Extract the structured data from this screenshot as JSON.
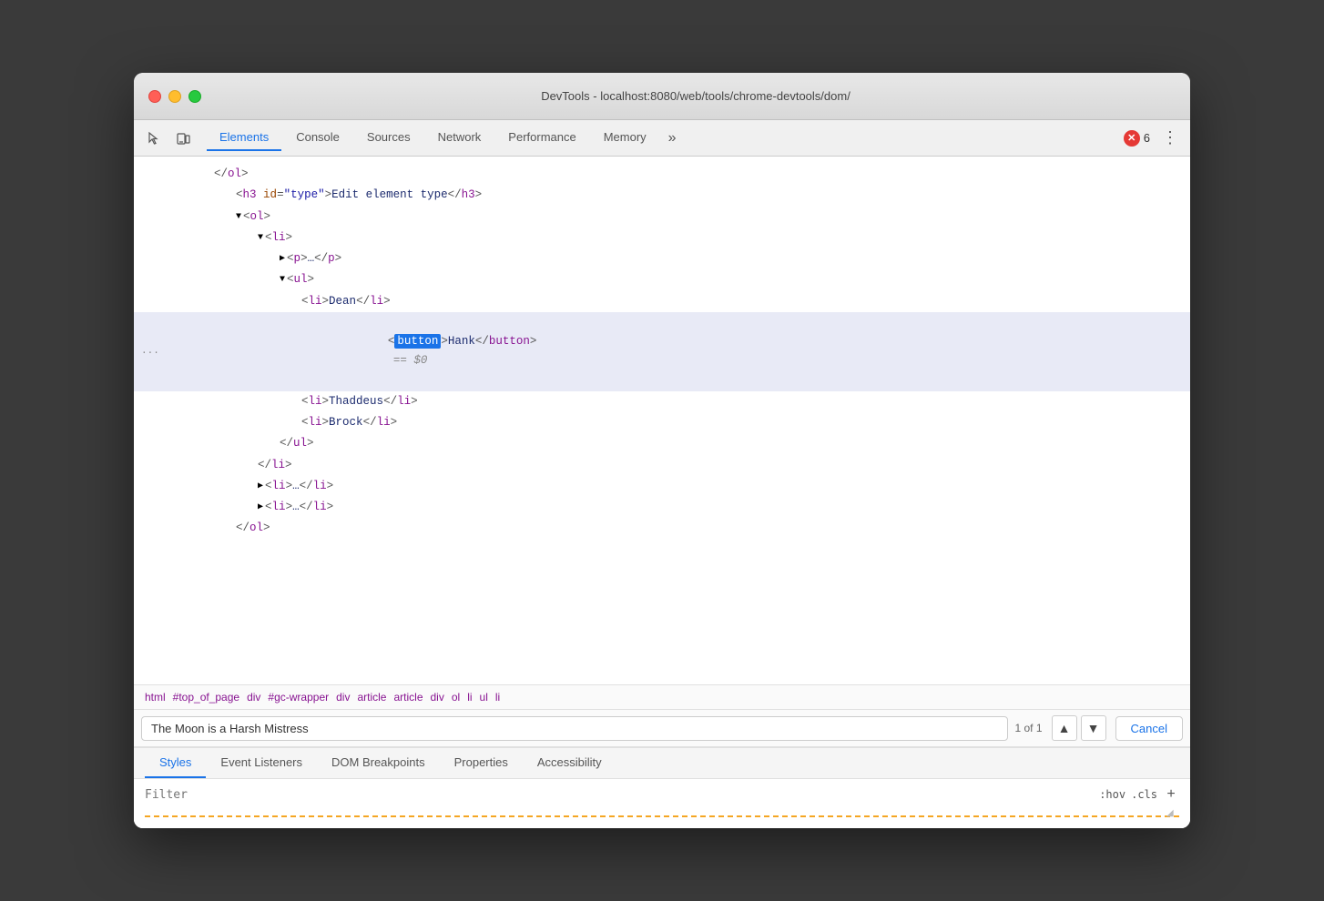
{
  "window": {
    "title": "DevTools - localhost:8080/web/tools/chrome-devtools/dom/"
  },
  "tabs": [
    {
      "label": "Elements",
      "active": true
    },
    {
      "label": "Console",
      "active": false
    },
    {
      "label": "Sources",
      "active": false
    },
    {
      "label": "Network",
      "active": false
    },
    {
      "label": "Performance",
      "active": false
    },
    {
      "label": "Memory",
      "active": false
    }
  ],
  "error_count": "6",
  "dom_lines": [
    {
      "indent": 3,
      "content": "</ol>",
      "type": "tag_close"
    },
    {
      "indent": 4,
      "content": "<h3 id=\"type\">Edit element type</h3>",
      "type": "tag_inline"
    },
    {
      "indent": 4,
      "content": "▼<ol>",
      "type": "tag_open",
      "triangle": "down"
    },
    {
      "indent": 5,
      "content": "▼<li>",
      "type": "tag_open",
      "triangle": "down"
    },
    {
      "indent": 6,
      "content": "▶<p>…</p>",
      "type": "tag_collapsed",
      "triangle": "right"
    },
    {
      "indent": 6,
      "content": "▼<ul>",
      "type": "tag_open",
      "triangle": "down"
    },
    {
      "indent": 7,
      "content": "<li>Dean</li>",
      "type": "tag_inline"
    },
    {
      "indent": 7,
      "content": "<button>Hank</button> == $0",
      "type": "tag_selected",
      "highlighted": true
    },
    {
      "indent": 7,
      "content": "<li>Thaddeus</li>",
      "type": "tag_inline"
    },
    {
      "indent": 7,
      "content": "<li>Brock</li>",
      "type": "tag_inline"
    },
    {
      "indent": 6,
      "content": "</ul>",
      "type": "tag_close"
    },
    {
      "indent": 5,
      "content": "</li>",
      "type": "tag_close"
    },
    {
      "indent": 5,
      "content": "▶<li>…</li>",
      "type": "tag_collapsed",
      "triangle": "right"
    },
    {
      "indent": 5,
      "content": "▶<li>…</li>",
      "type": "tag_collapsed",
      "triangle": "right"
    },
    {
      "indent": 4,
      "content": "</ol>",
      "type": "tag_close"
    }
  ],
  "breadcrumbs": [
    "html",
    "#top_of_page",
    "div",
    "#gc-wrapper",
    "div",
    "article",
    "article",
    "div",
    "ol",
    "li",
    "ul",
    "li"
  ],
  "search": {
    "placeholder": "The Moon is a Harsh Mistress",
    "count": "1 of 1"
  },
  "panel_tabs": [
    "Styles",
    "Event Listeners",
    "DOM Breakpoints",
    "Properties",
    "Accessibility"
  ],
  "filter": {
    "placeholder": "Filter",
    "hov": ":hov",
    "cls": ".cls",
    "add": "+"
  }
}
